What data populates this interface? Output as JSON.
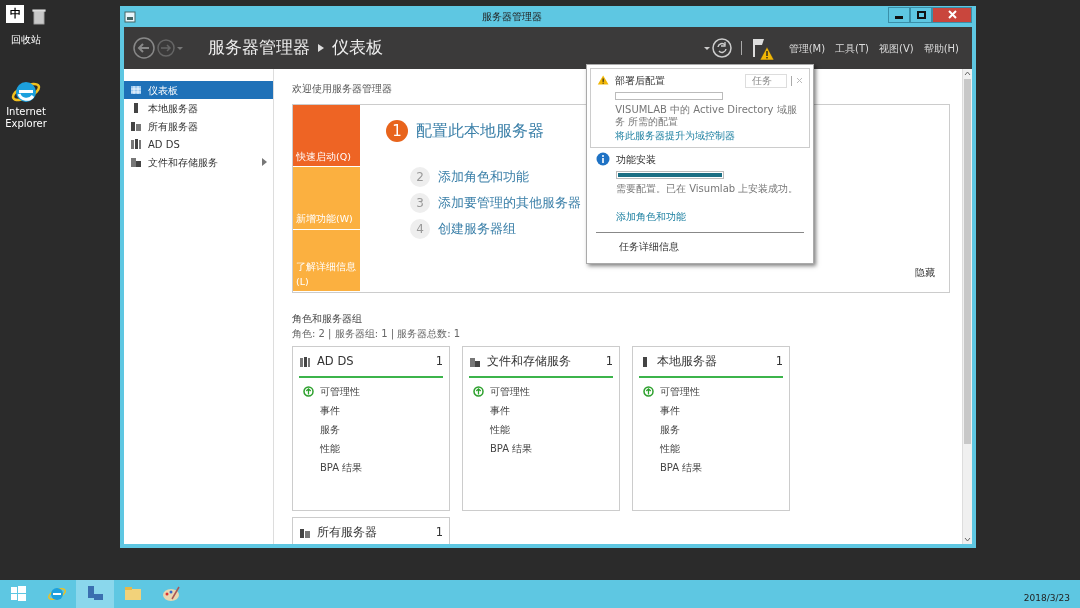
{
  "desktop": {
    "ime_indicator": "中",
    "icons": [
      {
        "label": "回收站"
      },
      {
        "label": "Internet Explorer"
      }
    ]
  },
  "window": {
    "title": "服务器管理器"
  },
  "header": {
    "root": "服务器管理器",
    "page": "仪表板",
    "menus": [
      "管理(M)",
      "工具(T)",
      "视图(V)",
      "帮助(H)"
    ]
  },
  "sidebar": {
    "items": [
      {
        "label": "仪表板",
        "selected": true,
        "expandable": false
      },
      {
        "label": "本地服务器",
        "selected": false,
        "expandable": false
      },
      {
        "label": "所有服务器",
        "selected": false,
        "expandable": false
      },
      {
        "label": "AD DS",
        "selected": false,
        "expandable": false
      },
      {
        "label": "文件和存储服务",
        "selected": false,
        "expandable": true
      }
    ]
  },
  "welcome": {
    "title": "欢迎使用服务器管理器",
    "tiles": [
      {
        "label": "快速启动(Q)",
        "selected": true
      },
      {
        "label": "新增功能(W)",
        "selected": false
      },
      {
        "label": "了解详细信息(L)",
        "selected": false
      }
    ],
    "steps": [
      {
        "number": "1",
        "label": "配置此本地服务器",
        "primary": true
      },
      {
        "number": "2",
        "label": "添加角色和功能",
        "primary": false
      },
      {
        "number": "3",
        "label": "添加要管理的其他服务器",
        "primary": false
      },
      {
        "number": "4",
        "label": "创建服务器组",
        "primary": false
      }
    ],
    "hide": "隐藏"
  },
  "roles": {
    "title": "角色和服务器组",
    "summary": "角色: 2 | 服务器组: 1 | 服务器总数: 1",
    "cards": [
      {
        "title": "AD DS",
        "count": "1",
        "items": [
          {
            "label": "可管理性",
            "ok": true
          },
          {
            "label": "事件",
            "ok": false
          },
          {
            "label": "服务",
            "ok": false
          },
          {
            "label": "性能",
            "ok": false
          },
          {
            "label": "BPA 结果",
            "ok": false
          }
        ]
      },
      {
        "title": "文件和存储服务",
        "count": "1",
        "items": [
          {
            "label": "可管理性",
            "ok": true
          },
          {
            "label": "事件",
            "ok": false
          },
          {
            "label": "性能",
            "ok": false
          },
          {
            "label": "BPA 结果",
            "ok": false
          }
        ]
      },
      {
        "title": "本地服务器",
        "count": "1",
        "items": [
          {
            "label": "可管理性",
            "ok": true
          },
          {
            "label": "事件",
            "ok": false
          },
          {
            "label": "服务",
            "ok": false
          },
          {
            "label": "性能",
            "ok": false
          },
          {
            "label": "BPA 结果",
            "ok": false
          }
        ]
      },
      {
        "title": "所有服务器",
        "count": "1"
      }
    ]
  },
  "notifications": {
    "items": [
      {
        "kind": "warning",
        "title": "部署后配置",
        "level": 0,
        "task_button": "任务",
        "text": "VISUMLAB 中的 Active Directory 域服务 所需的配置",
        "link": "将此服务器提升为域控制器"
      },
      {
        "kind": "info",
        "title": "功能安装",
        "level": 1,
        "text": "需要配置。已在 Visumlab 上安装成功。",
        "link": "添加角色和功能"
      }
    ],
    "footer": "任务详细信息"
  },
  "taskbar": {
    "date": "2018/3/23"
  }
}
